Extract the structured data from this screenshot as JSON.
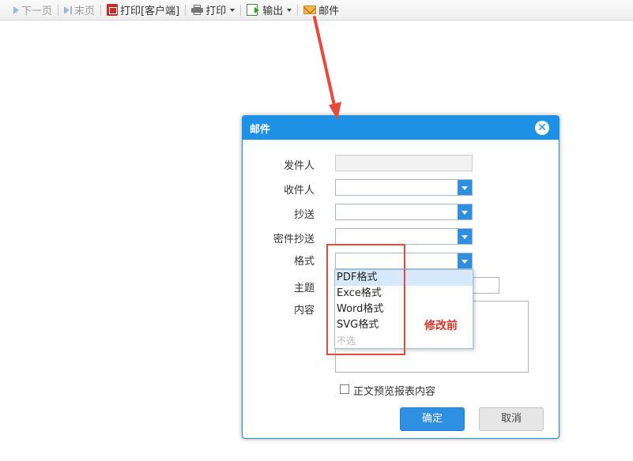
{
  "toolbar": {
    "next_page": "下一页",
    "last_page": "末页",
    "print_client": "打印[客户端]",
    "print": "打印",
    "export": "输出",
    "mail": "邮件"
  },
  "dialog": {
    "title": "邮件",
    "close_glyph": "✕",
    "fields": {
      "sender_label": "发件人",
      "recipient_label": "收件人",
      "cc_label": "抄送",
      "bcc_label": "密件抄送",
      "format_label": "格式",
      "subject_label": "主题",
      "content_label": "内容"
    },
    "format_options": [
      "PDF格式",
      "Exce格式",
      "Word格式",
      "SVG格式",
      "不选"
    ],
    "selected_option": "PDF格式",
    "checkbox_label": "正文预览报表内容",
    "ok_label": "确定",
    "cancel_label": "取消"
  },
  "annotation": {
    "label": "修改前",
    "color": "#e8493f"
  },
  "colors": {
    "accent": "#1e90e6",
    "button_primary": "#2f8fe0",
    "annotation_red": "#e8493f"
  },
  "icons": {
    "next_page": "play-icon",
    "last_page": "skip-end-icon",
    "print_client": "pdf-icon",
    "print": "printer-icon",
    "export": "export-icon",
    "mail": "envelope-icon",
    "close": "close-circle-icon"
  }
}
